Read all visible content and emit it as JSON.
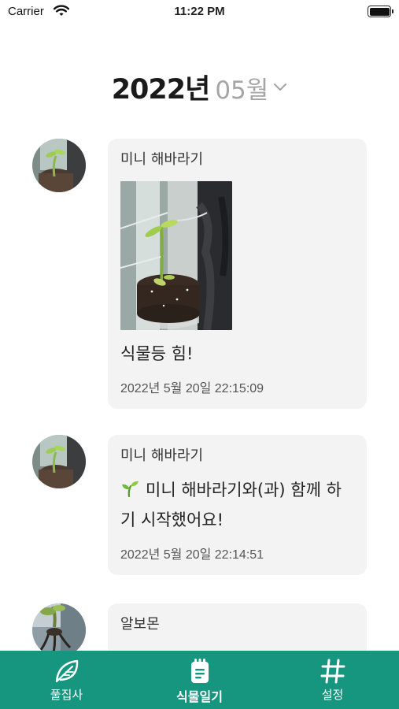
{
  "status_bar": {
    "carrier": "Carrier",
    "time": "11:22 PM",
    "battery_level": 1.0,
    "icons": [
      "wifi-icon",
      "battery-icon"
    ]
  },
  "header": {
    "year": "2022년",
    "month": "05월",
    "dropdown_icon": "chevron-down-icon"
  },
  "feed": {
    "entries": [
      {
        "plant_name": "미니 해바라기",
        "has_photo": true,
        "content": "식물등 힘!",
        "timestamp": "2022년 5월 20일 22:15:09"
      },
      {
        "plant_name": "미니 해바라기",
        "content_icon": "sprout-icon",
        "content": "미니 해바라기와(과) 함께 하기 시작했어요!",
        "timestamp": "2022년 5월 20일 22:14:51"
      },
      {
        "plant_name": "알보몬"
      }
    ]
  },
  "tab_bar": {
    "tabs": [
      {
        "label": "풀집사",
        "icon": "leaf-icon",
        "active": false
      },
      {
        "label": "식물일기",
        "icon": "notepad-icon",
        "active": true
      },
      {
        "label": "설정",
        "icon": "hashtag-icon",
        "active": false
      }
    ]
  },
  "colors": {
    "accent": "#16957f",
    "card_background": "#f3f3f3",
    "month_text": "#a5a5a5"
  }
}
